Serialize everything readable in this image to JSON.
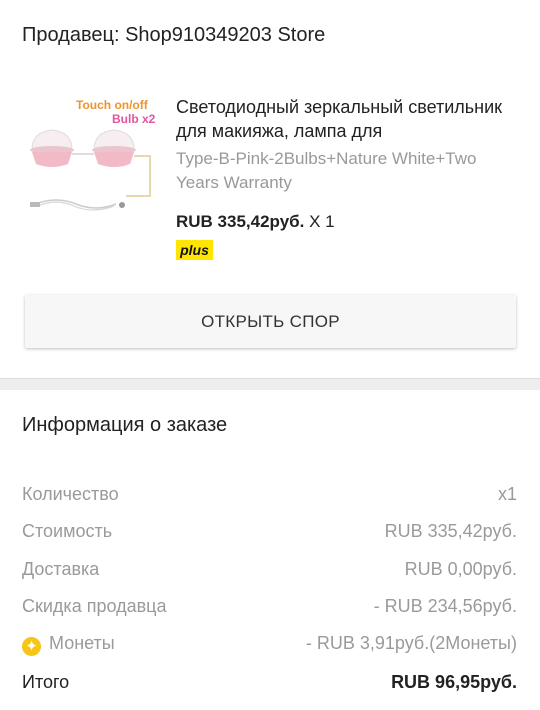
{
  "seller": {
    "text": "Продавец: Shop910349203 Store"
  },
  "product": {
    "image": {
      "line1": "Touch on/off",
      "line2": "Bulb x2",
      "icon": "mirror-lamp-product-image"
    },
    "title": "Светодиодный зеркальный светильник для макияжа, лампа для",
    "variant": "Type-B-Pink-2Bulbs+Nature White+Two Years Warranty",
    "price": "RUB 335,42руб.",
    "quantity": "X 1",
    "badge": "plus"
  },
  "dispute_button": {
    "label": "ОТКРЫТЬ СПОР"
  },
  "order_info": {
    "title": "Информация о заказе",
    "rows": [
      {
        "label": "Количество",
        "value": "x1"
      },
      {
        "label": "Стоимость",
        "value": "RUB 335,42руб."
      },
      {
        "label": "Доставка",
        "value": "RUB 0,00руб."
      },
      {
        "label": "Скидка продавца",
        "value": "- RUB 234,56руб."
      },
      {
        "label": "Монеты",
        "value": "- RUB 3,91руб.(2Монеты)",
        "icon": "coin-icon"
      },
      {
        "label": "Итого",
        "value": "RUB 96,95руб."
      }
    ]
  },
  "colors": {
    "accent_yellow": "#ffe500",
    "coin": "#f5c518",
    "muted_text": "#9a9a9a"
  }
}
